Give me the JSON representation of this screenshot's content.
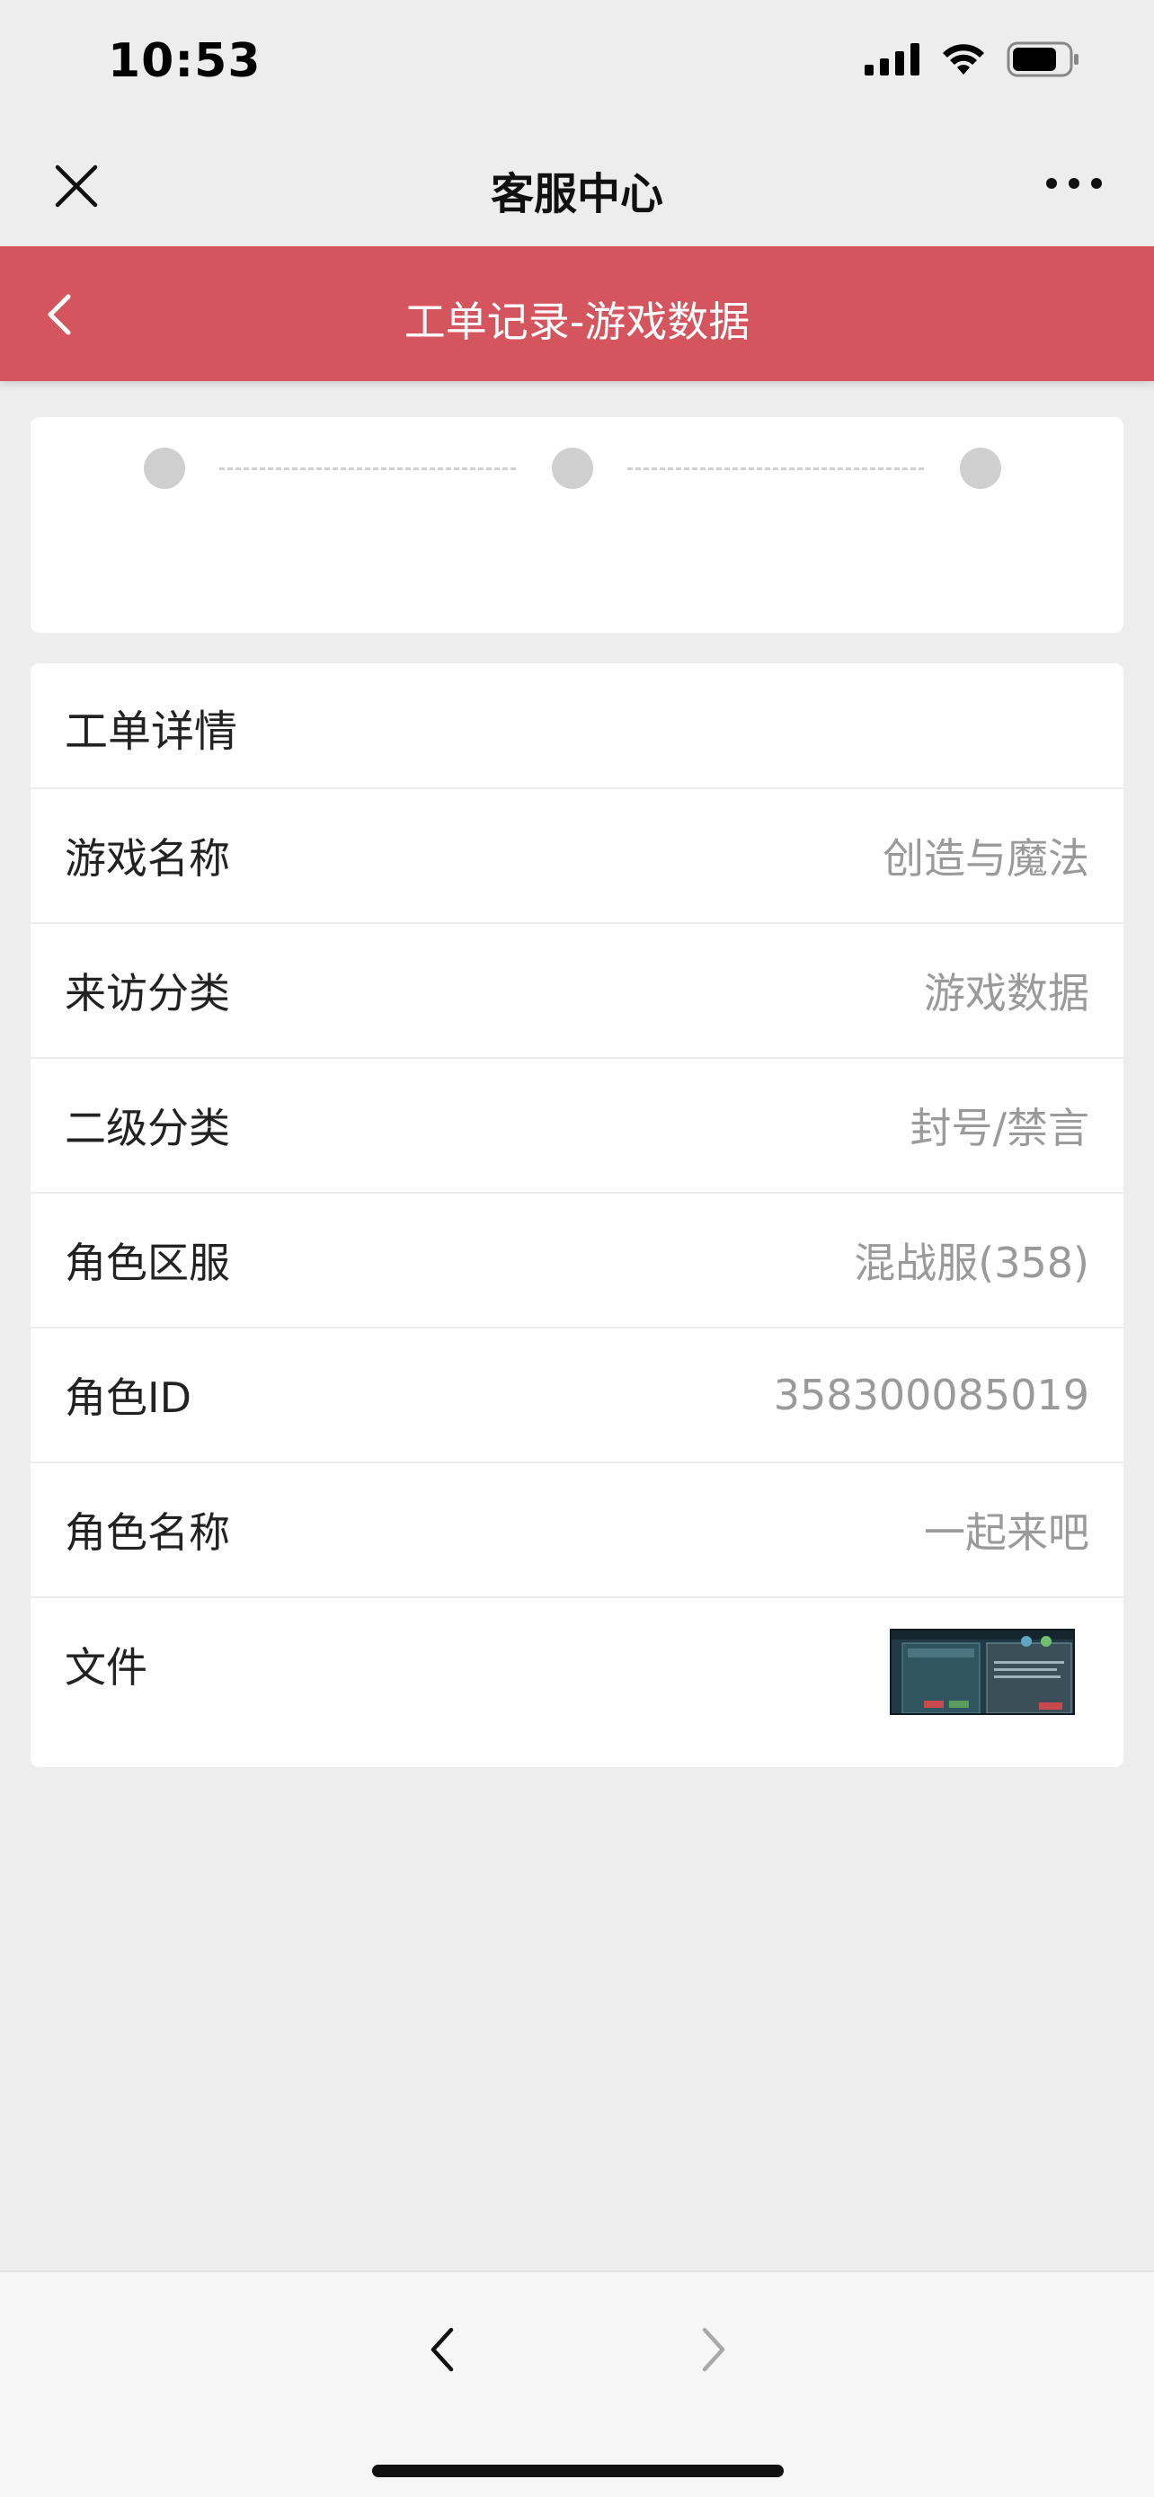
{
  "status_bar": {
    "time": "10:53",
    "icons": [
      "signal-icon",
      "wifi-icon",
      "battery-icon"
    ]
  },
  "nav": {
    "title": "客服中心",
    "close_icon": "close-icon",
    "more_icon": "more-icon"
  },
  "header": {
    "title": "工单记录-游戏数据",
    "back_icon": "chevron-left-icon",
    "background_color": "#d4555e"
  },
  "steps": {
    "count": 3
  },
  "details": {
    "title": "工单详情",
    "rows": [
      {
        "label": "游戏名称",
        "value": "创造与魔法"
      },
      {
        "label": "来访分类",
        "value": "游戏数据"
      },
      {
        "label": "二级分类",
        "value": "封号/禁言"
      },
      {
        "label": "角色区服",
        "value": "混战服(358)"
      },
      {
        "label": "角色ID",
        "value": "358300085019"
      },
      {
        "label": "角色名称",
        "value": "一起来吧"
      }
    ],
    "file": {
      "label": "文件",
      "thumbnail_icon": "screenshot-thumbnail"
    }
  },
  "bottom_bar": {
    "back_icon": "chevron-left-icon",
    "forward_icon": "chevron-right-icon"
  }
}
